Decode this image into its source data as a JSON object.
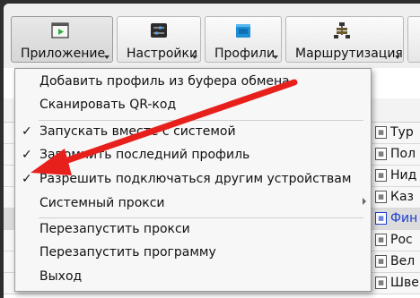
{
  "toolbar": {
    "buttons": [
      {
        "label": "Приложение",
        "icon": "app-window-icon"
      },
      {
        "label": "Настройки",
        "icon": "sliders-icon"
      },
      {
        "label": "Профили",
        "icon": "folder-icon"
      },
      {
        "label": "Маршрутизация",
        "icon": "network-icon"
      }
    ]
  },
  "menu": {
    "items": [
      {
        "label": "Добавить профиль из буфера обмена"
      },
      {
        "label": "Сканировать QR-код"
      },
      {
        "label": "Запускать вместе с системой",
        "checked": true
      },
      {
        "label": "Запомнить последний профиль",
        "checked": true
      },
      {
        "label": "Разрешить подключаться другим устройствам",
        "checked": true
      },
      {
        "label": "Системный прокси",
        "submenu": true
      },
      {
        "label": "Перезапустить прокси"
      },
      {
        "label": "Перезапустить программу"
      },
      {
        "label": "Выход"
      }
    ],
    "check_glyph": "✓"
  },
  "profile_list": {
    "rows": [
      "Тур",
      "Пол",
      "Нид",
      "Каз",
      "Фин",
      "Рос",
      "Вел",
      "Шве"
    ]
  },
  "colors": {
    "annotation_arrow": "#e8201c",
    "link_blue": "#1a3fd0"
  }
}
